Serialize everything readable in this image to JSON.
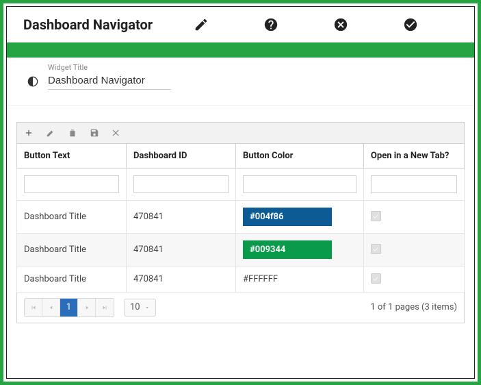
{
  "header": {
    "title": "Dashboard Navigator"
  },
  "config": {
    "widget_title_label": "Widget Title",
    "widget_title_value": "Dashboard Navigator"
  },
  "columns": {
    "c0": "Button Text",
    "c1": "Dashboard ID",
    "c2": "Button Color",
    "c3": "Open in a New Tab?"
  },
  "rows": [
    {
      "text": "Dashboard Title",
      "id": "470841",
      "color": "#004f86",
      "color_bg": "#0d5b95",
      "color_fg": "#ffffff",
      "newtab": true
    },
    {
      "text": "Dashboard Title",
      "id": "470841",
      "color": "#009344",
      "color_bg": "#0a9a4c",
      "color_fg": "#ffffff",
      "newtab": true
    },
    {
      "text": "Dashboard Title",
      "id": "470841",
      "color": "#FFFFFF",
      "color_bg": "",
      "color_fg": "#444444",
      "newtab": true
    }
  ],
  "pager": {
    "current": "1",
    "size": "10",
    "info": "1 of 1 pages (3 items)"
  }
}
